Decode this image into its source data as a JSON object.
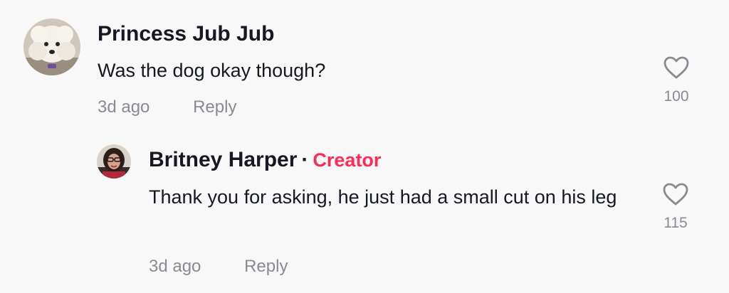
{
  "comments": [
    {
      "author": "Princess Jub Jub",
      "text": "Was the dog okay though?",
      "time": "3d ago",
      "reply_label": "Reply",
      "likes": "100",
      "avatar_icon": "white-poodle-avatar"
    }
  ],
  "reply": {
    "author": "Britney Harper",
    "separator": "·",
    "badge": "Creator",
    "text": "Thank you for asking, he just had a small cut on his leg",
    "time": "3d ago",
    "reply_label": "Reply",
    "likes": "115",
    "avatar_icon": "person-avatar"
  },
  "colors": {
    "background": "#f8f8f8",
    "creator_badge": "#fe2c55",
    "secondary_text": "#8a8b91",
    "primary_text": "#161823"
  },
  "icons": {
    "like": "heart-outline-icon"
  }
}
